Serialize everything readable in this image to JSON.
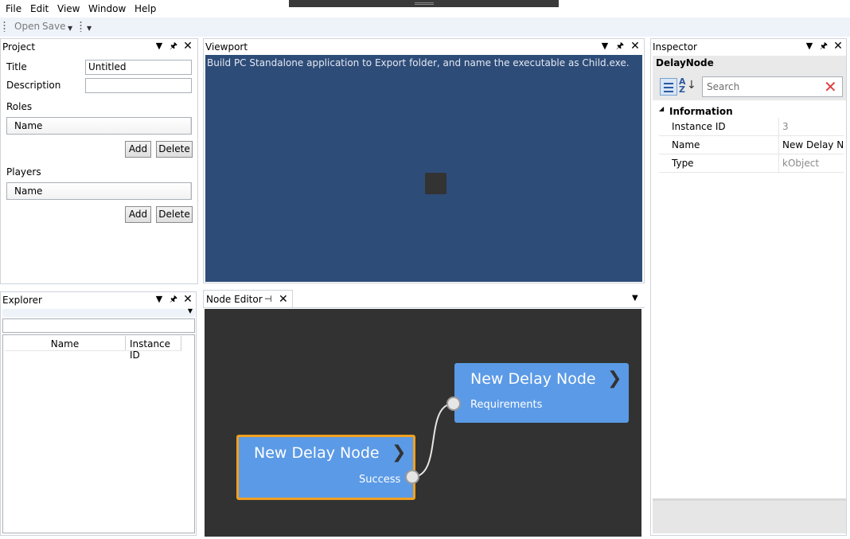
{
  "menu": [
    "File",
    "Edit",
    "View",
    "Window",
    "Help"
  ],
  "toolbar": {
    "open_label": "Open",
    "save_label": "Save"
  },
  "project": {
    "title": "Project",
    "title_label": "Title",
    "title_value": "Untitled",
    "description_label": "Description",
    "description_value": "",
    "roles_label": "Roles",
    "roles_column": "Name",
    "players_label": "Players",
    "players_column": "Name",
    "add_label": "Add",
    "delete_label": "Delete"
  },
  "explorer": {
    "title": "Explorer",
    "filter_value": "",
    "columns": [
      "Name",
      "Instance ID"
    ]
  },
  "viewport": {
    "title": "Viewport",
    "message": "Build PC Standalone application to Export folder, and name the executable as Child.exe."
  },
  "node_editor": {
    "tab_label": "Node Editor",
    "nodes": [
      {
        "title": "New Delay Node",
        "port_label": "Requirements",
        "selected": false
      },
      {
        "title": "New Delay Node",
        "port_label": "Success",
        "selected": true
      }
    ]
  },
  "inspector": {
    "title": "Inspector",
    "object_title": "DelayNode",
    "search_placeholder": "Search",
    "category": "Information",
    "properties": [
      {
        "name": "Instance ID",
        "value": "3",
        "readonly": true
      },
      {
        "name": "Name",
        "value": "New Delay Node",
        "readonly": false
      },
      {
        "name": "Type",
        "value": "kObject",
        "readonly": true
      }
    ]
  },
  "colors": {
    "viewport_bg": "#2e4c78",
    "node_bg": "#5b9ae6",
    "node_selected_border": "#f0a020",
    "canvas_bg": "#323232"
  }
}
